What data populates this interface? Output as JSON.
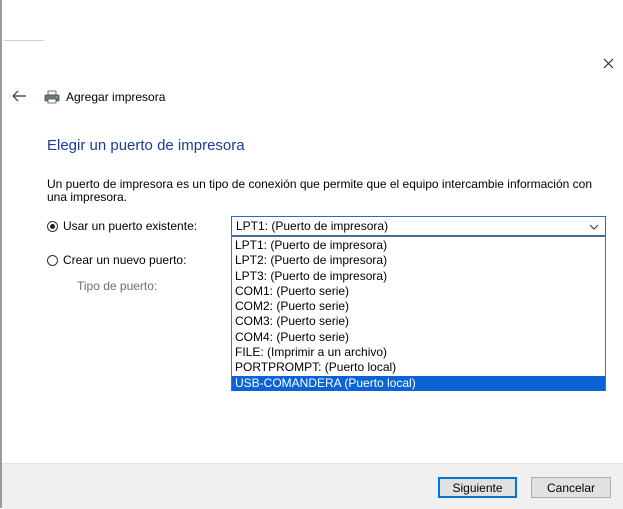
{
  "window": {
    "title": "Agregar impresora",
    "close_icon": "close-icon",
    "back_icon": "back-arrow-icon",
    "printer_icon": "printer-icon"
  },
  "page": {
    "heading": "Elegir un puerto de impresora",
    "description": "Un puerto de impresora es un tipo de conexión que permite que el equipo intercambie información con una impresora."
  },
  "options": {
    "existing_port_label": "Usar un puerto existente:",
    "existing_port_checked": true,
    "new_port_label": "Crear un nuevo puerto:",
    "new_port_checked": false,
    "port_type_label": "Tipo de puerto:"
  },
  "port_select": {
    "selected_value": "LPT1: (Puerto de impresora)",
    "items": [
      "LPT1: (Puerto de impresora)",
      "LPT2: (Puerto de impresora)",
      "LPT3: (Puerto de impresora)",
      "COM1: (Puerto serie)",
      "COM2: (Puerto serie)",
      "COM3: (Puerto serie)",
      "COM4: (Puerto serie)",
      "FILE: (Imprimir a un archivo)",
      "PORTPROMPT: (Puerto local)",
      "USB-COMANDERA (Puerto local)"
    ],
    "highlighted_item": "USB-COMANDERA (Puerto local)"
  },
  "footer": {
    "next_label": "Siguiente",
    "cancel_label": "Cancelar"
  },
  "colors": {
    "heading": "#1a3b9c",
    "accent": "#0a64d6",
    "footer_bg": "#f0f0f0"
  }
}
